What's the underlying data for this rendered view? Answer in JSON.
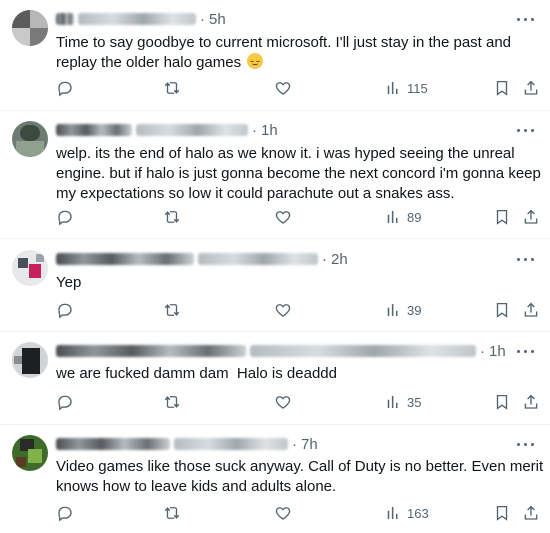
{
  "posts": [
    {
      "time": "5h",
      "text": "Time to say goodbye to current microsoft. I'll just stay in the past and replay the older halo games",
      "emoji": "relieved-face",
      "views": "115"
    },
    {
      "time": "1h",
      "text": "welp. its the end of halo as we know it. i was hyped seeing the unreal engine. but if halo is just gonna become the next concord i'm gonna keep my expectations so low it could parachute out a snakes ass.",
      "views": "89"
    },
    {
      "time": "2h",
      "text": "Yep",
      "views": "39"
    },
    {
      "time": "1h",
      "text": "we are fucked damm dam  Halo is deaddd",
      "views": "35"
    },
    {
      "time": "7h",
      "text": "Video games like those suck anyway. Call of Duty is no better. Even merit knows how to leave kids and adults alone.",
      "views": "163"
    }
  ],
  "icons": {
    "reply": "reply-icon",
    "repost": "repost-icon",
    "like": "heart-icon",
    "views": "analytics-icon",
    "bookmark": "bookmark-icon",
    "share": "share-icon",
    "more": "more-icon"
  },
  "colors": {
    "text": "#0f1419",
    "muted": "#536471",
    "divider": "#eff3f4"
  }
}
